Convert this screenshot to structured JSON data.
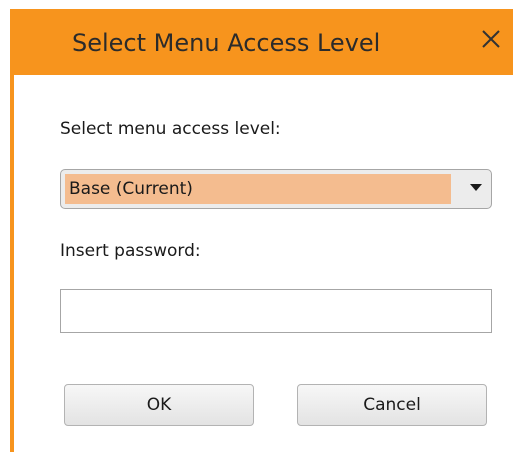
{
  "dialog": {
    "title": "Select Menu Access Level",
    "close_icon": "close-icon",
    "accent_color": "#f7941d",
    "selection_highlight": "#f4bc8f"
  },
  "access_level": {
    "label": "Select menu access level:",
    "selected_value": "Base (Current)",
    "dropdown_icon": "chevron-down-icon"
  },
  "password": {
    "label": "Insert password:",
    "value": ""
  },
  "buttons": {
    "ok_label": "OK",
    "cancel_label": "Cancel"
  }
}
